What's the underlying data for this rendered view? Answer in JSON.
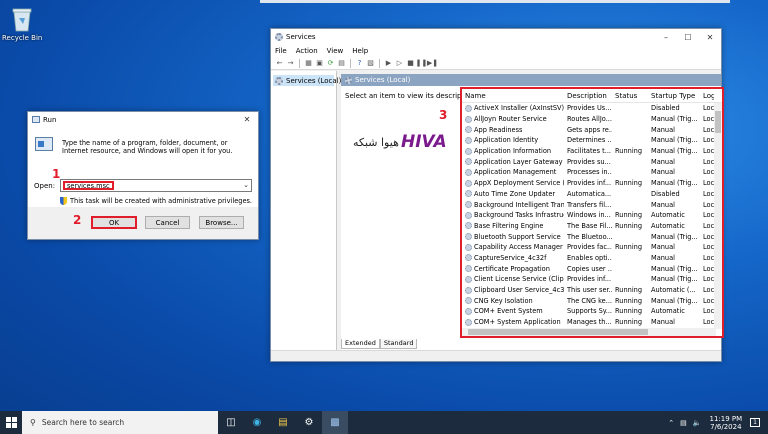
{
  "desktop": {
    "recycle_bin_label": "Recycle Bin"
  },
  "services_window": {
    "title": "Services",
    "menu": [
      "File",
      "Action",
      "View",
      "Help"
    ],
    "tree_item": "Services (Local)",
    "pane_title": "Services (Local)",
    "select_prompt": "Select an item to view its description.",
    "columns": [
      "Name",
      "Description",
      "Status",
      "Startup Type",
      "Log"
    ],
    "rows": [
      [
        "ActiveX Installer (AxInstSV)",
        "Provides Us...",
        "",
        "Disabled",
        "Loc"
      ],
      [
        "AllJoyn Router Service",
        "Routes AllJo...",
        "",
        "Manual (Trig...",
        "Loc"
      ],
      [
        "App Readiness",
        "Gets apps re...",
        "",
        "Manual",
        "Loc"
      ],
      [
        "Application Identity",
        "Determines ...",
        "",
        "Manual (Trig...",
        "Loc"
      ],
      [
        "Application Information",
        "Facilitates t...",
        "Running",
        "Manual (Trig...",
        "Loc"
      ],
      [
        "Application Layer Gateway ...",
        "Provides su...",
        "",
        "Manual",
        "Loc"
      ],
      [
        "Application Management",
        "Processes in...",
        "",
        "Manual",
        "Loc"
      ],
      [
        "AppX Deployment Service (...",
        "Provides inf...",
        "Running",
        "Manual (Trig...",
        "Loc"
      ],
      [
        "Auto Time Zone Updater",
        "Automatica...",
        "",
        "Disabled",
        "Loc"
      ],
      [
        "Background Intelligent Tran...",
        "Transfers fil...",
        "",
        "Manual",
        "Loc"
      ],
      [
        "Background Tasks Infrastruc...",
        "Windows in...",
        "Running",
        "Automatic",
        "Loc"
      ],
      [
        "Base Filtering Engine",
        "The Base Fil...",
        "Running",
        "Automatic",
        "Loc"
      ],
      [
        "Bluetooth Support Service",
        "The Bluetoo...",
        "",
        "Manual (Trig...",
        "Loc"
      ],
      [
        "Capability Access Manager ...",
        "Provides fac...",
        "Running",
        "Manual",
        "Loc"
      ],
      [
        "CaptureService_4c32f",
        "Enables opti...",
        "",
        "Manual",
        "Loc"
      ],
      [
        "Certificate Propagation",
        "Copies user ...",
        "",
        "Manual (Trig...",
        "Loc"
      ],
      [
        "Client License Service (ClipS...",
        "Provides inf...",
        "",
        "Manual (Trig...",
        "Loc"
      ],
      [
        "Clipboard User Service_4c32f",
        "This user ser...",
        "Running",
        "Automatic (...",
        "Loc"
      ],
      [
        "CNG Key Isolation",
        "The CNG ke...",
        "Running",
        "Manual (Trig...",
        "Loc"
      ],
      [
        "COM+ Event System",
        "Supports Sy...",
        "Running",
        "Automatic",
        "Loc"
      ],
      [
        "COM+ System Application",
        "Manages th...",
        "Running",
        "Manual",
        "Loc"
      ]
    ],
    "tabs": [
      "Extended",
      "Standard"
    ],
    "watermark_text": "HIVA هیوا شبکه"
  },
  "run_dialog": {
    "title": "Run",
    "description": "Type the name of a program, folder, document, or Internet resource, and Windows will open it for you.",
    "open_label": "Open:",
    "open_value": "services.msc",
    "admin_note": "This task will be created with administrative privileges.",
    "ok_label": "OK",
    "cancel_label": "Cancel",
    "browse_label": "Browse..."
  },
  "markers": {
    "m1": "1",
    "m2": "2",
    "m3": "3"
  },
  "taskbar": {
    "search_placeholder": "Search here to search",
    "time": "11:19 PM",
    "date": "7/6/2024",
    "notification_count": "1"
  },
  "colors": {
    "highlight": "#e11d2b",
    "desktop": "#1466c8",
    "taskbar": "#1c2c3e"
  }
}
